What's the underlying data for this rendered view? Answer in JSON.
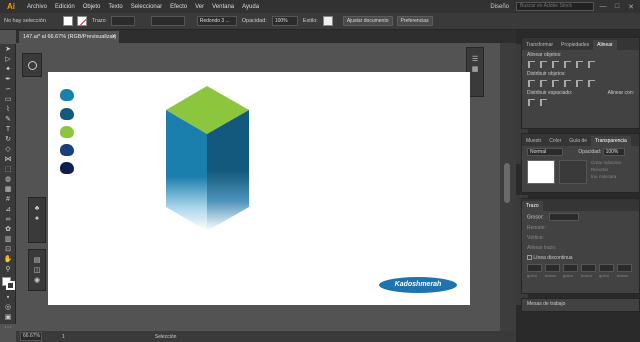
{
  "app": {
    "logo": "Ai"
  },
  "menu": [
    "Archivo",
    "Edición",
    "Objeto",
    "Texto",
    "Seleccionar",
    "Efecto",
    "Ver",
    "Ventana",
    "Ayuda"
  ],
  "menubar_right": {
    "workspace": "Diseño",
    "stock_placeholder": "Buscar en Adobe Stock",
    "minimize": "—",
    "maximize": "□",
    "close": "✕"
  },
  "control": {
    "selection": "No hay selección",
    "stroke_label": "Trazo",
    "brush_dropdown": "Redondo 3 ...",
    "opacity_label": "Opacidad:",
    "opacity_value": "100%",
    "style_label": "Estilo:",
    "ajustar": "Ajustar documento",
    "preferencias": "Preferencias"
  },
  "document": {
    "tab": "147.ai* al 66.67% (RGB/Previsualizar)",
    "close": "✕",
    "brand_text": "Kadoshmerah"
  },
  "status": {
    "zoom": "66.67%",
    "page": "1",
    "mode": "Selección"
  },
  "panels": {
    "align": {
      "tabs": [
        "Transformar",
        "Propiedades",
        "Alinear"
      ],
      "align_objects": "Alinear objetos:",
      "distribute_objects": "Distribuir objetos:",
      "distribute_spacing": "Distribuir espaciado:",
      "align_to": "Alinear con:"
    },
    "transparency": {
      "tabs": [
        "Muestr",
        "Color",
        "Guía de",
        "Transparencia"
      ],
      "blend_mode": "Normal",
      "opacity_label": "Opacidad:",
      "opacity_value": "100%",
      "make_mask": "Crear máscara",
      "clip": "Recortar",
      "invert_mask": "Inv. máscara"
    },
    "stroke": {
      "title": "Trazo",
      "weight_label": "Grosor:",
      "cap_label": "Remate:",
      "corner_label": "Vértice:",
      "align_label": "Alinear trazo:",
      "dashed_label": "Línea discontinua",
      "dash_labels": [
        "guión",
        "hueco",
        "guión",
        "hueco",
        "guión",
        "hueco"
      ]
    },
    "artboards": {
      "title": "Mesas de trabajo"
    }
  },
  "colors": {
    "accent_orange": "#ff9a00",
    "cube_top": "#8cc63f",
    "cube_left": "#1b7fad",
    "cube_right": "#13597d",
    "oval": "#1f74b0",
    "swatches": [
      "#1b7fad",
      "#13597d",
      "#8cc63f",
      "#1b3f7d",
      "#0f1f4d"
    ]
  }
}
